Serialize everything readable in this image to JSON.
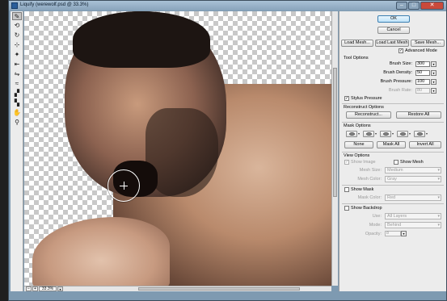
{
  "window": {
    "title": "Liquify (werewolf.psd @ 33.3%)"
  },
  "status": {
    "zoom": "33.3%"
  },
  "buttons": {
    "ok": "OK",
    "cancel": "Cancel",
    "load_mesh": "Load Mesh...",
    "load_last_mesh": "Load Last Mesh",
    "save_mesh": "Save Mesh...",
    "reconstruct": "Reconstruct...",
    "restore_all": "Restore All",
    "none": "None",
    "mask_all": "Mask All",
    "invert_all": "Invert All"
  },
  "advanced_mode": {
    "label": "Advanced Mode",
    "checked": true
  },
  "tool_options": {
    "title": "Tool Options",
    "brush_size": {
      "label": "Brush Size:",
      "value": "300"
    },
    "brush_density": {
      "label": "Brush Density:",
      "value": "50"
    },
    "brush_pressure": {
      "label": "Brush Pressure:",
      "value": "100"
    },
    "brush_rate": {
      "label": "Brush Rate:",
      "value": "80"
    },
    "stylus_pressure": {
      "label": "Stylus Pressure",
      "checked": true
    }
  },
  "reconstruct_options": {
    "title": "Reconstruct Options"
  },
  "mask_options": {
    "title": "Mask Options"
  },
  "view_options": {
    "title": "View Options",
    "show_image": {
      "label": "Show Image",
      "checked": true
    },
    "show_mesh": {
      "label": "Show Mesh",
      "checked": false
    },
    "mesh_size": {
      "label": "Mesh Size:",
      "value": "Medium"
    },
    "mesh_color": {
      "label": "Mesh Color:",
      "value": "Gray"
    },
    "show_mask": {
      "label": "Show Mask",
      "checked": false
    },
    "mask_color": {
      "label": "Mask Color:",
      "value": "Red"
    },
    "show_backdrop": {
      "label": "Show Backdrop",
      "checked": false
    },
    "use": {
      "label": "Use:",
      "value": "All Layers"
    },
    "mode": {
      "label": "Mode:",
      "value": "Behind"
    },
    "opacity": {
      "label": "Opacity:",
      "value": "8"
    }
  },
  "tools": [
    "forward-warp",
    "reconstruct",
    "twirl",
    "pucker",
    "bloat",
    "push-left",
    "mirror",
    "turbulence",
    "freeze-mask",
    "thaw-mask",
    "hand",
    "zoom"
  ]
}
